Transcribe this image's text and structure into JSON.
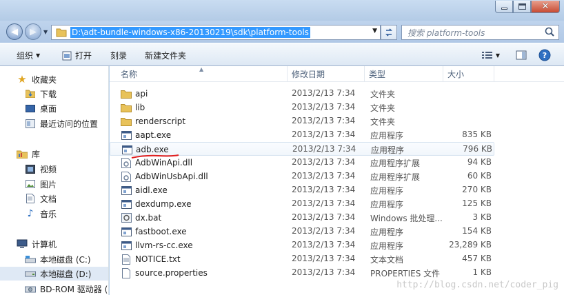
{
  "window": {
    "address_path": "D:\\adt-bundle-windows-x86-20130219\\sdk\\platform-tools",
    "search_placeholder": "搜索 platform-tools"
  },
  "toolbar": {
    "organize": "组织",
    "open": "打开",
    "burn": "刻录",
    "new_folder": "新建文件夹"
  },
  "sidebar": {
    "favorites": "收藏夹",
    "fav_items": [
      "下载",
      "桌面",
      "最近访问的位置"
    ],
    "libraries": "库",
    "lib_items": [
      "视频",
      "图片",
      "文档",
      "音乐"
    ],
    "computer": "计算机",
    "drives": [
      "本地磁盘 (C:)",
      "本地磁盘 (D:)",
      "BD-ROM 驱动器 (G"
    ]
  },
  "columns": {
    "name": "名称",
    "date": "修改日期",
    "type": "类型",
    "size": "大小"
  },
  "files": [
    {
      "name": "api",
      "date": "2013/2/13 7:34",
      "type": "文件夹",
      "size": "",
      "icon": "folder-icon"
    },
    {
      "name": "lib",
      "date": "2013/2/13 7:34",
      "type": "文件夹",
      "size": "",
      "icon": "folder-icon"
    },
    {
      "name": "renderscript",
      "date": "2013/2/13 7:34",
      "type": "文件夹",
      "size": "",
      "icon": "folder-icon"
    },
    {
      "name": "aapt.exe",
      "date": "2013/2/13 7:34",
      "type": "应用程序",
      "size": "835 KB",
      "icon": "exe-icon"
    },
    {
      "name": "adb.exe",
      "date": "2013/2/13 7:34",
      "type": "应用程序",
      "size": "796 KB",
      "icon": "exe-icon"
    },
    {
      "name": "AdbWinApi.dll",
      "date": "2013/2/13 7:34",
      "type": "应用程序扩展",
      "size": "94 KB",
      "icon": "dll-icon"
    },
    {
      "name": "AdbWinUsbApi.dll",
      "date": "2013/2/13 7:34",
      "type": "应用程序扩展",
      "size": "60 KB",
      "icon": "dll-icon"
    },
    {
      "name": "aidl.exe",
      "date": "2013/2/13 7:34",
      "type": "应用程序",
      "size": "270 KB",
      "icon": "exe-icon"
    },
    {
      "name": "dexdump.exe",
      "date": "2013/2/13 7:34",
      "type": "应用程序",
      "size": "125 KB",
      "icon": "exe-icon"
    },
    {
      "name": "dx.bat",
      "date": "2013/2/13 7:34",
      "type": "Windows 批处理...",
      "size": "3 KB",
      "icon": "bat-icon"
    },
    {
      "name": "fastboot.exe",
      "date": "2013/2/13 7:34",
      "type": "应用程序",
      "size": "154 KB",
      "icon": "exe-icon"
    },
    {
      "name": "llvm-rs-cc.exe",
      "date": "2013/2/13 7:34",
      "type": "应用程序",
      "size": "23,289 KB",
      "icon": "exe-icon"
    },
    {
      "name": "NOTICE.txt",
      "date": "2013/2/13 7:34",
      "type": "文本文档",
      "size": "457 KB",
      "icon": "txt-icon"
    },
    {
      "name": "source.properties",
      "date": "2013/2/13 7:34",
      "type": "PROPERTIES 文件",
      "size": "1 KB",
      "icon": "file-icon"
    }
  ],
  "watermark": "http://blog.csdn.net/coder_pig"
}
